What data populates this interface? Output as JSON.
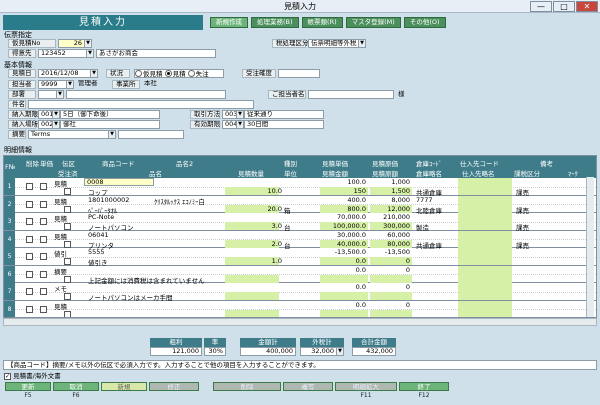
{
  "window": {
    "title": "見積入力",
    "min": "—",
    "max": "□",
    "close": "✕"
  },
  "screen_title": "見積入力",
  "tabs": [
    "新規作成",
    "処理業務(B)",
    "帳票類(R)",
    "マスタ登録(M)",
    "その他(O)"
  ],
  "header_section": {
    "label": "伝票指定",
    "est_no_label": "仮見積No",
    "est_no_value": "26",
    "customer_label": "得意先",
    "customer_code": "123452",
    "customer_name": "あさがお商会",
    "tax_label": "税処理区分",
    "tax_value": "伝票明細等外税"
  },
  "basic_section": {
    "label": "基本情報",
    "date_label": "見積日",
    "date_value": "2016/12/08",
    "status_label": "状況",
    "status_options": [
      "仮見積",
      "見積",
      "失注"
    ],
    "status_selected": 1,
    "accuracy_label": "受注確度",
    "staff_label": "担当者",
    "staff_code": "9999",
    "staff_name": "管理者",
    "office_label": "事業所",
    "office_value": "本社",
    "dept_label": "部署",
    "contact_label": "ご担当者名",
    "contact_suffix": "様",
    "subject_label": "件名",
    "delivery_label": "納入期限",
    "delivery_code": "001",
    "delivery_text": "5日（御下命後）",
    "trade_label": "取引方法",
    "trade_code": "003",
    "trade_text": "従来通り",
    "place_label": "納入場所",
    "place_code": "002",
    "place_text": "御社",
    "valid_label": "有効期限",
    "valid_code": "004",
    "valid_text": "30日間",
    "note_label": "摘要",
    "note_value": "Terms"
  },
  "detail_section": {
    "label": "明細情報",
    "headers_top": [
      "F№",
      "削除",
      "単価",
      "伝区",
      "商品コード",
      "品名2",
      "種別",
      "見積単価",
      "見積原価",
      "倉庫ｺｰﾄﾞ",
      "仕入先コード",
      "備考"
    ],
    "headers_bottom": [
      "受注済",
      "品名",
      "見積数量",
      "単位",
      "見積金額",
      "見積原額",
      "倉庫略名",
      "仕入先略名",
      "課税区分",
      "ﾏｰｸ"
    ],
    "rows": [
      {
        "n": "1",
        "kbn": "見積",
        "code": "0008",
        "name2": "",
        "name": "コップ",
        "qty": "10.0",
        "unit": "",
        "price": "100.0",
        "amount": "150",
        "cost": "1,000",
        "costamt": "1,500",
        "wh": "",
        "whname": "共通倉庫",
        "tax": "課売"
      },
      {
        "n": "2",
        "kbn": "見積",
        "code": "1801000002",
        "name2": "ｸﾘｽﾀﾙｯｸｽ ｴｺﾉﾐｰ白",
        "name": "ﾍﾟｰﾊﾟｰﾀｵﾙ",
        "qty": "20.0",
        "unit": "箱",
        "price": "400.0",
        "amount": "800.0",
        "cost": "8,000",
        "costamt": "12,000",
        "wh": "7777",
        "whname": "北陸倉庫",
        "tax": "課売"
      },
      {
        "n": "3",
        "kbn": "見積",
        "code": "PC-Note",
        "name2": "",
        "name": "ノートパソコン",
        "qty": "3.0",
        "unit": "台",
        "price": "70,000.0",
        "amount": "100,000.0",
        "cost": "210,000",
        "costamt": "300,000",
        "wh": "",
        "whname": "製造",
        "tax": "課売"
      },
      {
        "n": "4",
        "kbn": "見積",
        "code": "06041",
        "name2": "",
        "name": "プリンタ",
        "qty": "2.0",
        "unit": "台",
        "price": "30,000.0",
        "amount": "40,000.0",
        "cost": "60,000",
        "costamt": "80,000",
        "wh": "",
        "whname": "共通倉庫",
        "tax": "課売"
      },
      {
        "n": "5",
        "kbn": "値引",
        "code": "5555",
        "name2": "",
        "name": "値引き",
        "qty": "1.0",
        "unit": "",
        "price": "-13,500.0",
        "amount": "0.0",
        "cost": "-13,500",
        "costamt": "0",
        "wh": "",
        "whname": "",
        "tax": ""
      },
      {
        "n": "6",
        "kbn": "摘要",
        "code": "",
        "name2": "",
        "name": "上記金額には消費税は含まれていません",
        "qty": "",
        "unit": "",
        "price": "0.0",
        "amount": "",
        "cost": "0",
        "costamt": "",
        "wh": "",
        "whname": "",
        "tax": ""
      },
      {
        "n": "7",
        "kbn": "メモ",
        "code": "",
        "name2": "",
        "name": "ノートパソコンはメーカ手間",
        "qty": "",
        "unit": "",
        "price": "0.0",
        "amount": "",
        "cost": "0",
        "costamt": "",
        "wh": "",
        "whname": "",
        "tax": ""
      },
      {
        "n": "8",
        "kbn": "見積",
        "code": "",
        "name2": "",
        "name": "",
        "qty": "",
        "unit": "",
        "price": "0.0",
        "amount": "",
        "cost": "0",
        "costamt": "",
        "wh": "",
        "whname": "",
        "tax": ""
      }
    ]
  },
  "totals": {
    "profit_label": "粗利",
    "profit_value": "121,000",
    "rate_label": "率",
    "rate_value": "30%",
    "sum_label": "金額計",
    "sum_value": "400,000",
    "tax_label": "外税計",
    "tax_value": "32,000",
    "grand_label": "合計金額",
    "grand_value": "432,000"
  },
  "message": "【商品コード】摘要/メモ以外の伝区で必須入力です。入力することで他の項目を入力することができます。",
  "overseas_label": "見積書/海外文書",
  "fkeys": [
    {
      "label": "更新",
      "key": "F5",
      "state": "on"
    },
    {
      "label": "取消",
      "key": "F6",
      "state": "on"
    },
    {
      "label": "新規",
      "key": "",
      "state": "mid"
    },
    {
      "label": "修正",
      "key": "",
      "state": "off"
    },
    {
      "label": "削除",
      "key": "",
      "state": "off"
    },
    {
      "label": "複写",
      "key": "",
      "state": "off"
    },
    {
      "label": "明細拡大",
      "key": "F11",
      "state": "off"
    },
    {
      "label": "終了",
      "key": "F12",
      "state": "on"
    }
  ]
}
